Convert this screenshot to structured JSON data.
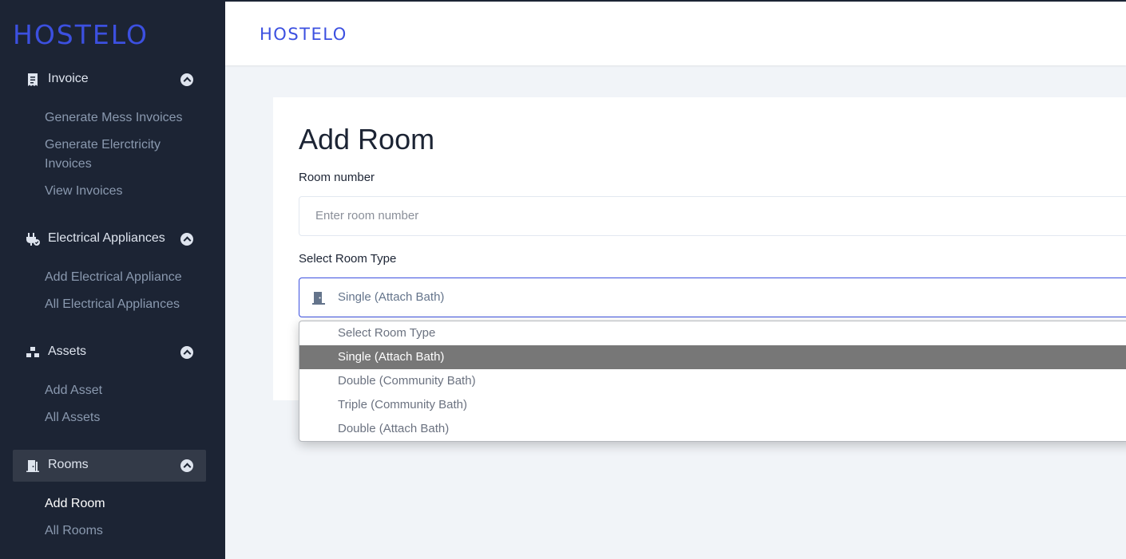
{
  "brand": {
    "name": "HOSTELO",
    "color": "#3c50e0"
  },
  "sidebar": {
    "groups": [
      {
        "label": "Invoice",
        "icon": "receipt-icon",
        "items": [
          "Generate Mess Invoices",
          "Generate Elerctricity Invoices",
          "View Invoices"
        ]
      },
      {
        "label": "Electrical Appliances",
        "icon": "plug-icon",
        "items": [
          "Add Electrical Appliance",
          "All Electrical Appliances"
        ]
      },
      {
        "label": "Assets",
        "icon": "boxes-icon",
        "items": [
          "Add Asset",
          "All Assets"
        ]
      },
      {
        "label": "Rooms",
        "icon": "door-icon",
        "items": [
          "Add Room",
          "All Rooms"
        ],
        "active": true
      }
    ],
    "active_item": "Add Room"
  },
  "form": {
    "title": "Add Room",
    "room_number_label": "Room number",
    "room_number_placeholder": "Enter room number",
    "room_type_label": "Select Room Type",
    "room_type_value": "Single (Attach Bath)",
    "room_type_options": [
      "Select Room Type",
      "Single (Attach Bath)",
      "Double (Community Bath)",
      "Triple (Community Bath)",
      "Double (Attach Bath)"
    ],
    "highlighted_option": "Single (Attach Bath)"
  },
  "colors": {
    "sidebar_bg": "#1c2434",
    "active_group_bg": "#333a48",
    "accent": "#3c50e0",
    "highlight": "#777777"
  }
}
